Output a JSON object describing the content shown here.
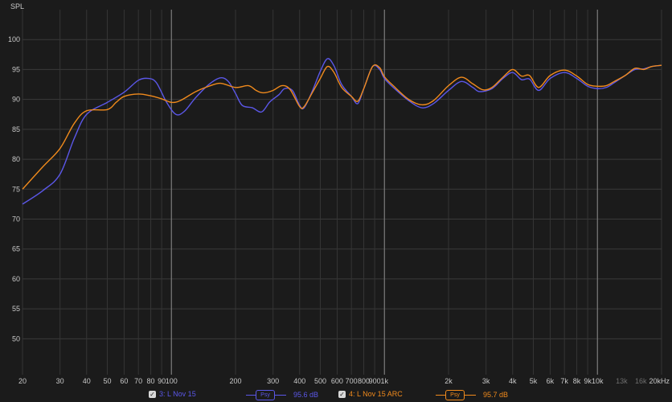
{
  "chart_data": {
    "type": "line",
    "ylabel": "SPL",
    "x_scale": "log",
    "xlim": [
      20,
      20000
    ],
    "ylim": [
      44,
      105
    ],
    "grid": true,
    "y_ticks": [
      50,
      55,
      60,
      65,
      70,
      75,
      80,
      85,
      90,
      95,
      100
    ],
    "x_ticks": [
      {
        "v": 20,
        "label": "20",
        "dim": false
      },
      {
        "v": 30,
        "label": "30",
        "dim": false
      },
      {
        "v": 40,
        "label": "40",
        "dim": false
      },
      {
        "v": 50,
        "label": "50",
        "dim": false
      },
      {
        "v": 60,
        "label": "60",
        "dim": false
      },
      {
        "v": 70,
        "label": "70",
        "dim": false
      },
      {
        "v": 80,
        "label": "80",
        "dim": false
      },
      {
        "v": 90,
        "label": "90",
        "dim": false
      },
      {
        "v": 100,
        "label": "100",
        "dim": false
      },
      {
        "v": 200,
        "label": "200",
        "dim": false
      },
      {
        "v": 300,
        "label": "300",
        "dim": false
      },
      {
        "v": 400,
        "label": "400",
        "dim": false
      },
      {
        "v": 500,
        "label": "500",
        "dim": false
      },
      {
        "v": 600,
        "label": "600",
        "dim": false
      },
      {
        "v": 700,
        "label": "700",
        "dim": false
      },
      {
        "v": 800,
        "label": "800",
        "dim": false
      },
      {
        "v": 900,
        "label": "900",
        "dim": false
      },
      {
        "v": 1000,
        "label": "1k",
        "dim": false
      },
      {
        "v": 2000,
        "label": "2k",
        "dim": false
      },
      {
        "v": 3000,
        "label": "3k",
        "dim": false
      },
      {
        "v": 4000,
        "label": "4k",
        "dim": false
      },
      {
        "v": 5000,
        "label": "5k",
        "dim": false
      },
      {
        "v": 6000,
        "label": "6k",
        "dim": false
      },
      {
        "v": 7000,
        "label": "7k",
        "dim": false
      },
      {
        "v": 8000,
        "label": "8k",
        "dim": false
      },
      {
        "v": 9000,
        "label": "9k",
        "dim": false
      },
      {
        "v": 10000,
        "label": "10k",
        "dim": false
      },
      {
        "v": 13000,
        "label": "13k",
        "dim": true
      },
      {
        "v": 16000,
        "label": "16k",
        "dim": true
      },
      {
        "v": 20000,
        "label": "20kHz",
        "dim": false
      }
    ],
    "decade_lines": [
      100,
      1000,
      10000
    ],
    "series": [
      {
        "name": "3: L Nov 15",
        "color": "#5b57e8",
        "level": "95.6 dB",
        "points": [
          [
            20,
            72.5
          ],
          [
            25,
            74.8
          ],
          [
            30,
            77.5
          ],
          [
            35,
            83.5
          ],
          [
            40,
            87.5
          ],
          [
            50,
            89.5
          ],
          [
            60,
            91.2
          ],
          [
            70,
            93.2
          ],
          [
            78,
            93.5
          ],
          [
            85,
            92.8
          ],
          [
            95,
            89.5
          ],
          [
            105,
            87.5
          ],
          [
            115,
            88.0
          ],
          [
            130,
            90.3
          ],
          [
            150,
            92.5
          ],
          [
            170,
            93.6
          ],
          [
            185,
            93.0
          ],
          [
            200,
            91.0
          ],
          [
            215,
            89.0
          ],
          [
            240,
            88.6
          ],
          [
            265,
            87.9
          ],
          [
            290,
            89.6
          ],
          [
            320,
            90.8
          ],
          [
            340,
            91.8
          ],
          [
            370,
            91.5
          ],
          [
            400,
            89.0
          ],
          [
            420,
            88.6
          ],
          [
            460,
            91.5
          ],
          [
            500,
            94.7
          ],
          [
            540,
            96.8
          ],
          [
            580,
            95.6
          ],
          [
            630,
            92.5
          ],
          [
            700,
            90.5
          ],
          [
            750,
            89.3
          ],
          [
            800,
            91.8
          ],
          [
            880,
            95.5
          ],
          [
            950,
            95.0
          ],
          [
            1000,
            93.5
          ],
          [
            1100,
            92.0
          ],
          [
            1300,
            89.8
          ],
          [
            1500,
            88.6
          ],
          [
            1700,
            89.3
          ],
          [
            2000,
            91.5
          ],
          [
            2300,
            93.0
          ],
          [
            2600,
            92.0
          ],
          [
            2800,
            91.3
          ],
          [
            3200,
            91.8
          ],
          [
            3600,
            93.5
          ],
          [
            4000,
            94.5
          ],
          [
            4400,
            93.3
          ],
          [
            4800,
            93.4
          ],
          [
            5300,
            91.5
          ],
          [
            6000,
            93.5
          ],
          [
            7000,
            94.5
          ],
          [
            8000,
            93.5
          ],
          [
            9000,
            92.2
          ],
          [
            10000,
            91.8
          ],
          [
            11000,
            92.0
          ],
          [
            12000,
            92.8
          ],
          [
            13500,
            94.0
          ],
          [
            15000,
            95.0
          ],
          [
            16500,
            95.1
          ],
          [
            18000,
            95.5
          ],
          [
            20000,
            95.7
          ]
        ]
      },
      {
        "name": "4: L Nov 15 ARC",
        "color": "#f08a1c",
        "level": "95.7 dB",
        "points": [
          [
            20,
            75.0
          ],
          [
            25,
            78.8
          ],
          [
            30,
            81.8
          ],
          [
            35,
            86.0
          ],
          [
            40,
            88.1
          ],
          [
            50,
            88.3
          ],
          [
            55,
            89.5
          ],
          [
            60,
            90.5
          ],
          [
            70,
            90.9
          ],
          [
            80,
            90.6
          ],
          [
            90,
            90.1
          ],
          [
            100,
            89.5
          ],
          [
            110,
            89.8
          ],
          [
            130,
            91.3
          ],
          [
            150,
            92.2
          ],
          [
            170,
            92.7
          ],
          [
            200,
            92.0
          ],
          [
            230,
            92.3
          ],
          [
            250,
            91.5
          ],
          [
            270,
            91.1
          ],
          [
            300,
            91.5
          ],
          [
            330,
            92.3
          ],
          [
            360,
            91.7
          ],
          [
            400,
            88.8
          ],
          [
            420,
            88.8
          ],
          [
            460,
            91.2
          ],
          [
            500,
            93.5
          ],
          [
            540,
            95.5
          ],
          [
            580,
            94.5
          ],
          [
            630,
            92.0
          ],
          [
            700,
            90.5
          ],
          [
            750,
            89.7
          ],
          [
            800,
            91.8
          ],
          [
            880,
            95.5
          ],
          [
            950,
            95.3
          ],
          [
            1000,
            93.8
          ],
          [
            1100,
            92.3
          ],
          [
            1300,
            90.0
          ],
          [
            1500,
            89.1
          ],
          [
            1700,
            89.8
          ],
          [
            2000,
            92.3
          ],
          [
            2300,
            93.7
          ],
          [
            2600,
            92.6
          ],
          [
            2900,
            91.6
          ],
          [
            3200,
            92.0
          ],
          [
            3600,
            93.7
          ],
          [
            4000,
            95.0
          ],
          [
            4400,
            93.9
          ],
          [
            4800,
            94.0
          ],
          [
            5300,
            92.0
          ],
          [
            6000,
            94.0
          ],
          [
            7000,
            94.9
          ],
          [
            8000,
            93.9
          ],
          [
            9000,
            92.5
          ],
          [
            10000,
            92.2
          ],
          [
            11000,
            92.3
          ],
          [
            12000,
            93.0
          ],
          [
            13500,
            94.0
          ],
          [
            15000,
            95.2
          ],
          [
            16500,
            95.0
          ],
          [
            18000,
            95.5
          ],
          [
            20000,
            95.7
          ]
        ]
      }
    ]
  },
  "legend": {
    "items": [
      {
        "label": "3: L Nov 15",
        "checkmark": "✓",
        "psy": "Psy",
        "level": "95.6 dB",
        "color": "#5b57e8"
      },
      {
        "label": "4: L Nov 15 ARC",
        "checkmark": "✓",
        "psy": "Psy",
        "level": "95.7 dB",
        "color": "#f08a1c"
      }
    ]
  }
}
